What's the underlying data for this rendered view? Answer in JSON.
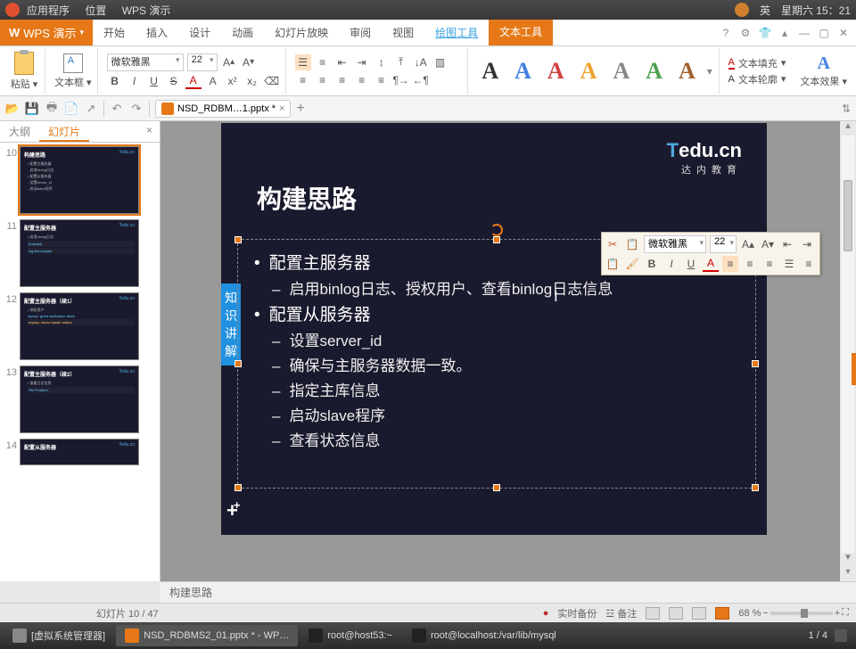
{
  "system": {
    "menu": [
      "应用程序",
      "位置",
      "WPS 演示"
    ],
    "ime": "英",
    "date": "星期六 15：21"
  },
  "app": {
    "title": "WPS 演示",
    "tabs": [
      "开始",
      "插入",
      "设计",
      "动画",
      "幻灯片放映",
      "审阅",
      "视图",
      "绘图工具",
      "文本工具"
    ],
    "active_tab": "文本工具"
  },
  "ribbon": {
    "paste": "粘贴",
    "textbox": "文本框",
    "font": "微软雅黑",
    "size": "22",
    "text_fill": "文本填充",
    "text_outline": "文本轮廓",
    "text_effect": "文本效果"
  },
  "doc": {
    "filename": "NSD_RDBM…1.pptx *",
    "close": "×",
    "add": "+"
  },
  "sidebar": {
    "tabs": {
      "outline": "大纲",
      "slides": "幻灯片"
    },
    "thumbs": [
      {
        "num": "10",
        "title": "构建思路"
      },
      {
        "num": "11",
        "title": "配置主服务器"
      },
      {
        "num": "12",
        "title": "配置主服务器（续1）"
      },
      {
        "num": "13",
        "title": "配置主服务器（续2）"
      },
      {
        "num": "14",
        "title": "配置从服务器"
      }
    ]
  },
  "slide": {
    "brand_t": "T",
    "brand_rest": "edu.cn",
    "brand_sub": "达内教育",
    "title": "构建思路",
    "side_label": "知识讲解",
    "bullets": [
      {
        "level": 1,
        "text": "配置主服务器"
      },
      {
        "level": 2,
        "text": "启用binlog日志、授权用户、查看binlog日志信息"
      },
      {
        "level": 1,
        "text": "配置从服务器"
      },
      {
        "level": 2,
        "text": "设置server_id"
      },
      {
        "level": 2,
        "text": "确保与主服务器数据一致。"
      },
      {
        "level": 2,
        "text": "指定主库信息"
      },
      {
        "level": 2,
        "text": "启动slave程序"
      },
      {
        "level": 2,
        "text": "查看状态信息"
      }
    ],
    "name_below": "构建思路"
  },
  "float": {
    "font": "微软雅黑",
    "size": "22"
  },
  "status": {
    "page": "幻灯片 10 / 47",
    "backup": "实时备份",
    "notes": "备注",
    "zoom": "68 %",
    "right": "1 / 4"
  },
  "taskbar": {
    "items": [
      "[虚拟系统管理器]",
      "NSD_RDBMS2_01.pptx * - WP…",
      "root@host53:~",
      "root@localhost:/var/lib/mysql"
    ]
  },
  "chart_data": null
}
